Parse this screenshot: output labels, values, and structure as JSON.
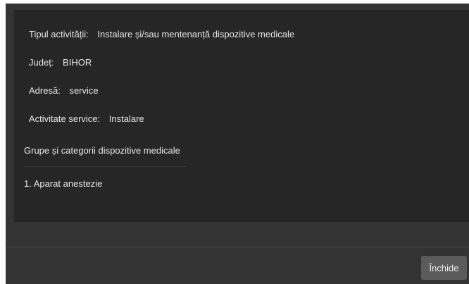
{
  "details": {
    "activity_type": {
      "label": "Tipul activității:",
      "value": "Instalare și/sau mentenanță dispozitive medicale"
    },
    "county": {
      "label": "Județ:",
      "value": "BIHOR"
    },
    "address": {
      "label": "Adresă:",
      "value": "service"
    },
    "service_activity": {
      "label": "Activitate service:",
      "value": "Instalare"
    }
  },
  "device_groups": {
    "title": "Grupe și categorii dispozitive medicale",
    "items": [
      "1. Aparat anestezie"
    ]
  },
  "footer": {
    "close_label": "Închide"
  }
}
